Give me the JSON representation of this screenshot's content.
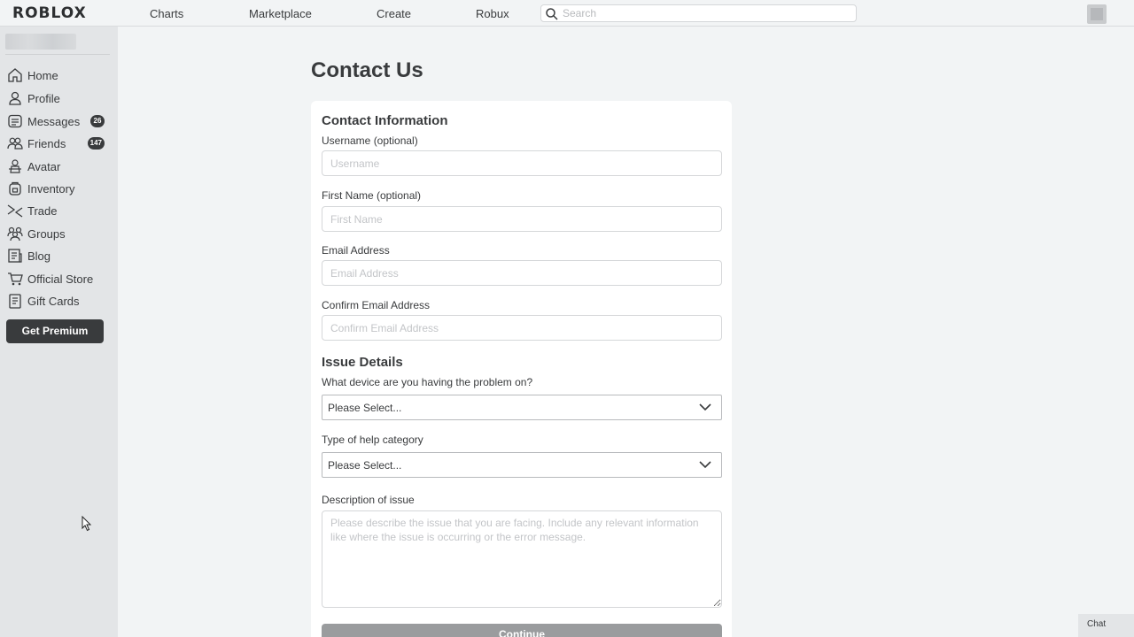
{
  "header": {
    "logo": "ROBLOX",
    "nav": [
      "Charts",
      "Marketplace",
      "Create",
      "Robux"
    ],
    "search_placeholder": "Search"
  },
  "sidebar": {
    "items": [
      {
        "label": "Home",
        "icon": "home-icon"
      },
      {
        "label": "Profile",
        "icon": "profile-icon"
      },
      {
        "label": "Messages",
        "icon": "messages-icon",
        "badge": "26"
      },
      {
        "label": "Friends",
        "icon": "friends-icon",
        "badge": "147"
      },
      {
        "label": "Avatar",
        "icon": "avatar-icon"
      },
      {
        "label": "Inventory",
        "icon": "inventory-icon"
      },
      {
        "label": "Trade",
        "icon": "trade-icon"
      },
      {
        "label": "Groups",
        "icon": "groups-icon"
      },
      {
        "label": "Blog",
        "icon": "blog-icon"
      },
      {
        "label": "Official Store",
        "icon": "store-icon"
      },
      {
        "label": "Gift Cards",
        "icon": "gift-card-icon"
      }
    ],
    "premium_button": "Get Premium"
  },
  "main": {
    "title": "Contact Us",
    "contact_section": "Contact Information",
    "username_label": "Username (optional)",
    "username_placeholder": "Username",
    "first_name_label": "First Name (optional)",
    "first_name_placeholder": "First Name",
    "email_label": "Email Address",
    "email_placeholder": "Email Address",
    "confirm_email_label": "Confirm Email Address",
    "confirm_email_placeholder": "Confirm Email Address",
    "issue_section": "Issue Details",
    "device_label": "What device are you having the problem on?",
    "device_value": "Please Select...",
    "category_label": "Type of help category",
    "category_value": "Please Select...",
    "description_label": "Description of issue",
    "description_placeholder": "Please describe the issue that you are facing. Include any relevant information like where the issue is occurring or the error message.",
    "continue_button": "Continue"
  },
  "chat": {
    "label": "Chat"
  }
}
